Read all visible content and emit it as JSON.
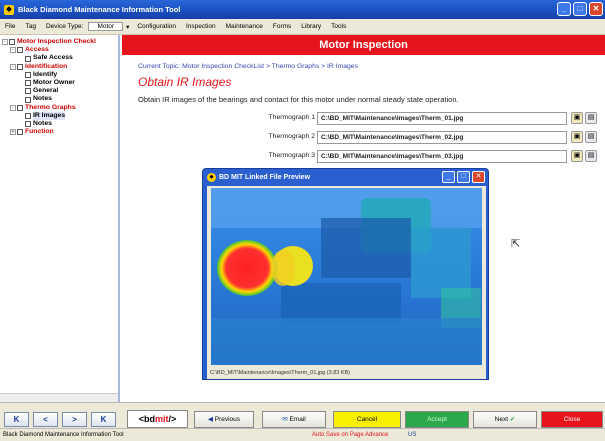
{
  "window": {
    "title": "Black Diamond Maintenance Information Tool"
  },
  "menu": {
    "items": [
      "File",
      "Tag",
      "Device Type:",
      "Configuration",
      "Inspection",
      "Maintenance",
      "Forms",
      "Library",
      "Tools"
    ],
    "device_type_value": "Motor"
  },
  "tree": [
    {
      "label": "Motor Inspection Checkl",
      "level": 0,
      "style": "red",
      "exp": "-"
    },
    {
      "label": "Access",
      "level": 1,
      "style": "red",
      "exp": "-"
    },
    {
      "label": "Safe Access",
      "level": 2,
      "style": "bold",
      "exp": ""
    },
    {
      "label": "Identification",
      "level": 1,
      "style": "red",
      "exp": "-"
    },
    {
      "label": "Identify",
      "level": 2,
      "style": "bold",
      "exp": ""
    },
    {
      "label": "Motor Owner",
      "level": 2,
      "style": "bold",
      "exp": ""
    },
    {
      "label": "General",
      "level": 2,
      "style": "bold",
      "exp": ""
    },
    {
      "label": "Notes",
      "level": 2,
      "style": "bold",
      "exp": ""
    },
    {
      "label": "Thermo Graphs",
      "level": 1,
      "style": "red",
      "exp": "-"
    },
    {
      "label": "IR Images",
      "level": 2,
      "style": "bold hl",
      "exp": ""
    },
    {
      "label": "Notes",
      "level": 2,
      "style": "bold",
      "exp": ""
    },
    {
      "label": "Function",
      "level": 1,
      "style": "red",
      "exp": "+"
    }
  ],
  "main": {
    "header": "Motor Inspection",
    "breadcrumb": "Current Topic: Motor Inspection CheckList > Thermo Graphs > IR Images",
    "title": "Obtain IR Images",
    "description": "Obtain IR images of the bearings and contact for this motor under normal steady state operation."
  },
  "thermographs": [
    {
      "label": "Thermograph 1",
      "value": "C:\\BD_MIT\\Maintenance\\Images\\Therm_01.jpg"
    },
    {
      "label": "Thermograph 2",
      "value": "C:\\BD_MIT\\Maintenance\\Images\\Therm_02.jpg"
    },
    {
      "label": "Thermograph 3",
      "value": "C:\\BD_MIT\\Maintenance\\Images\\Therm_03.jpg"
    }
  ],
  "dialog": {
    "title": "BD MIT Linked File Preview",
    "status": "C:\\BD_MIT\\Maintenance\\Images\\Therm_01.jpg (3.83 KB)"
  },
  "bottom": {
    "nav": [
      "K",
      "<",
      ">",
      "K"
    ],
    "logo_prefix": "<bd",
    "logo_mid": "mit",
    "logo_suffix": "/>",
    "previous": "Previous",
    "email": "Email",
    "cancel": "Cancel",
    "accept": "Accept",
    "next": "Next",
    "close": "Close"
  },
  "status": {
    "app": "Black Diamond Maintenance Information Tool",
    "autosave": "Auto Save on Page Advance",
    "locale": "US"
  },
  "colors": {
    "accent": "#e8141c",
    "cancel": "#f8f000",
    "accept": "#2aa84a",
    "close": "#e8141c"
  }
}
